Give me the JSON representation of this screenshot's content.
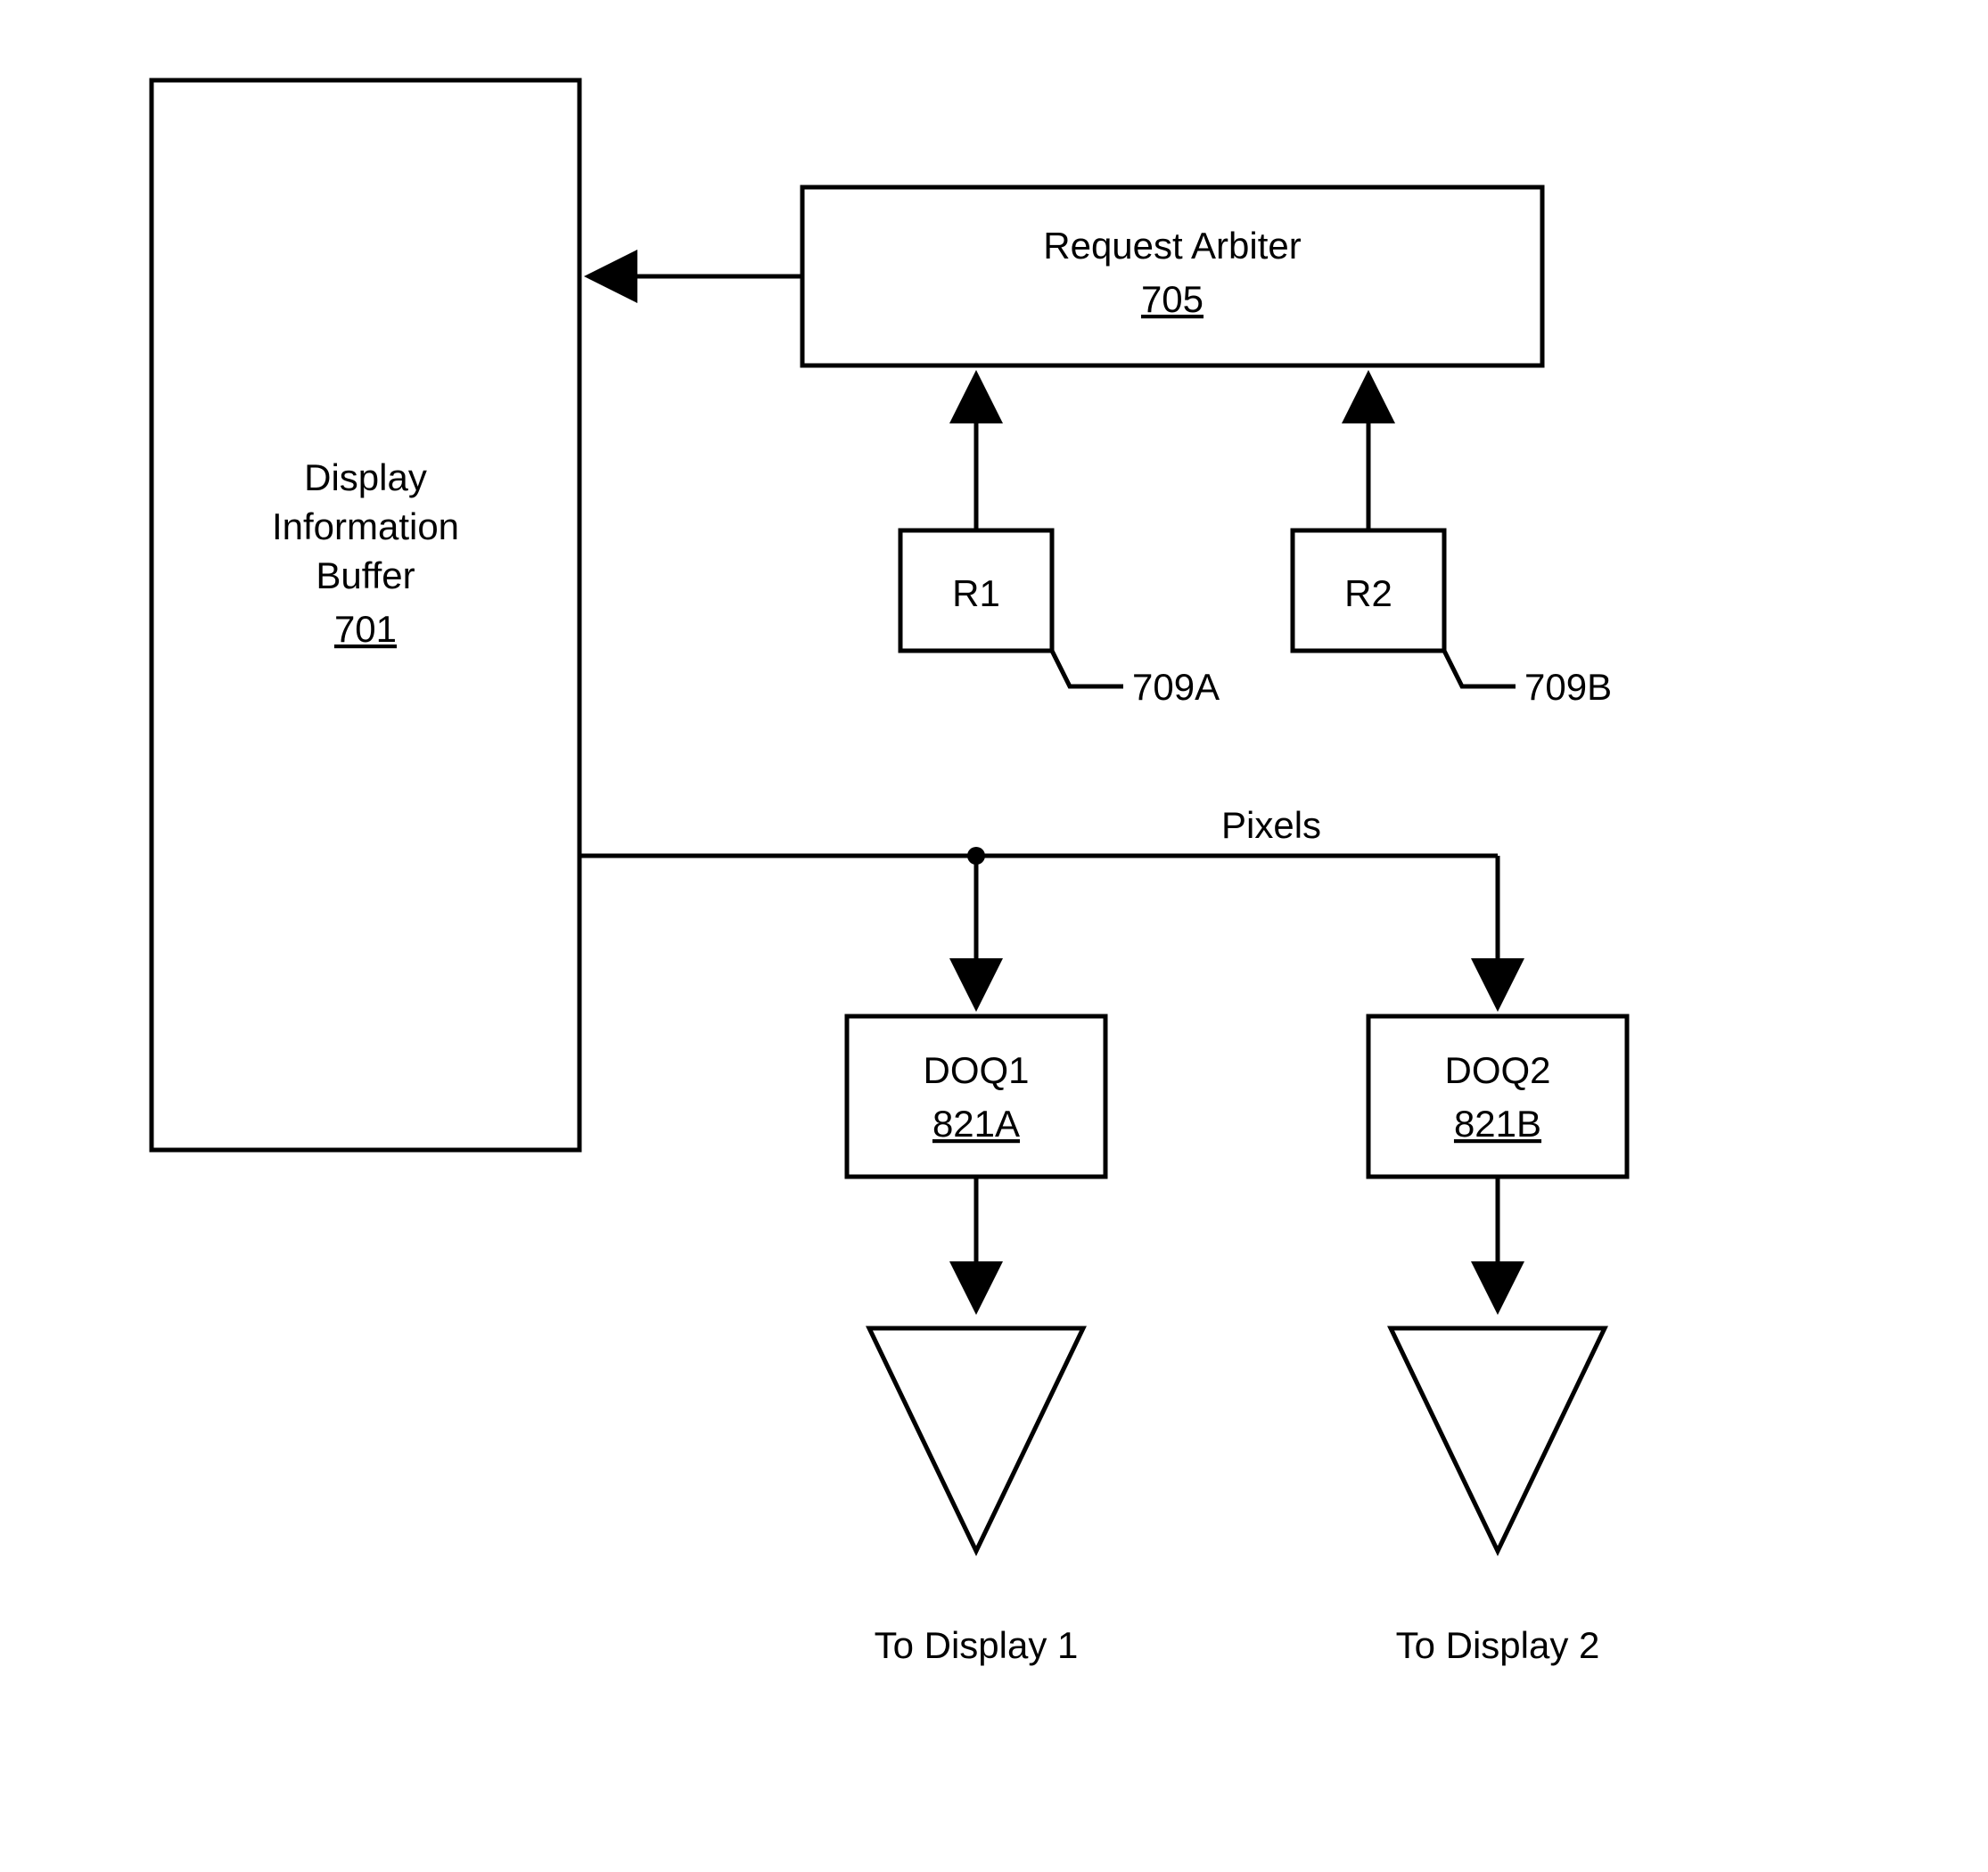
{
  "buffer": {
    "title_l1": "Display",
    "title_l2": "Information",
    "title_l3": "Buffer",
    "ref": "701"
  },
  "arbiter": {
    "title": "Request Arbiter",
    "ref": "705"
  },
  "r1": {
    "label": "R1",
    "ref": "709A"
  },
  "r2": {
    "label": "R2",
    "ref": "709B"
  },
  "bus_label": "Pixels",
  "doq1": {
    "label": "DOQ1",
    "ref": "821A"
  },
  "doq2": {
    "label": "DOQ2",
    "ref": "821B"
  },
  "out1": "To Display 1",
  "out2": "To Display 2"
}
